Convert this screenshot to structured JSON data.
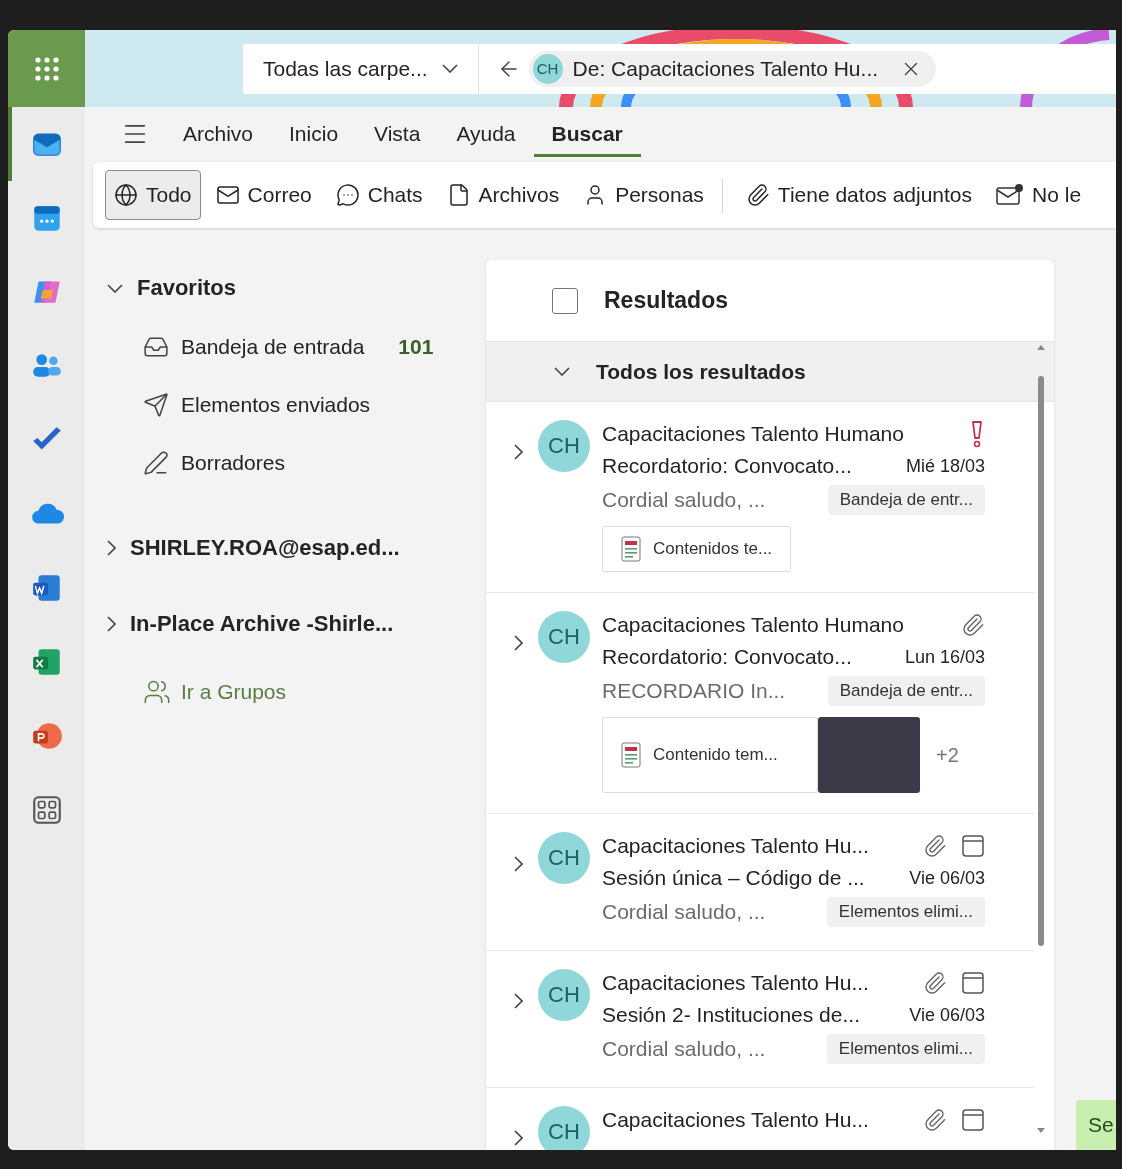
{
  "header": {
    "folder_scope": "Todas las carpe...",
    "search_chip": {
      "avatar": "CH",
      "text": "De: Capacitaciones Talento Hu..."
    }
  },
  "app_rail": [
    {
      "kind": "mail",
      "selected": true
    },
    {
      "kind": "calendar",
      "selected": false
    },
    {
      "kind": "copilot",
      "selected": false
    },
    {
      "kind": "people",
      "selected": false
    },
    {
      "kind": "todo",
      "selected": false
    },
    {
      "kind": "cloud",
      "selected": false
    },
    {
      "kind": "word",
      "selected": false
    },
    {
      "kind": "excel",
      "selected": false
    },
    {
      "kind": "powerpoint",
      "selected": false
    },
    {
      "kind": "apps",
      "selected": false
    }
  ],
  "ribbon_tabs": [
    {
      "label": "Archivo",
      "selected": false
    },
    {
      "label": "Inicio",
      "selected": false
    },
    {
      "label": "Vista",
      "selected": false
    },
    {
      "label": "Ayuda",
      "selected": false
    },
    {
      "label": "Buscar",
      "selected": true
    }
  ],
  "filters": [
    {
      "label": "Todo",
      "kind": "globe",
      "selected": true,
      "separator_before": false
    },
    {
      "label": "Correo",
      "kind": "mail",
      "selected": false,
      "separator_before": false
    },
    {
      "label": "Chats",
      "kind": "chat",
      "selected": false,
      "separator_before": false
    },
    {
      "label": "Archivos",
      "kind": "file",
      "selected": false,
      "separator_before": false
    },
    {
      "label": "Personas",
      "kind": "person",
      "selected": false,
      "separator_before": false
    },
    {
      "label": "Tiene datos adjuntos",
      "kind": "paperclip",
      "selected": false,
      "separator_before": true
    },
    {
      "label": "No le",
      "kind": "unread",
      "selected": false,
      "separator_before": false
    }
  ],
  "folders": {
    "favorites": {
      "label": "Favoritos",
      "expanded": true,
      "items": [
        {
          "label": "Bandeja de entrada",
          "kind": "inbox",
          "count": "101"
        },
        {
          "label": "Elementos enviados",
          "kind": "send"
        },
        {
          "label": "Borradores",
          "kind": "draft"
        }
      ]
    },
    "accounts": [
      {
        "label": "SHIRLEY.ROA@esap.ed...",
        "expanded": false
      },
      {
        "label": "In-Place Archive -Shirle...",
        "expanded": false
      }
    ],
    "groups_link": "Ir a Grupos"
  },
  "results": {
    "title": "Resultados",
    "select_all_checked": false,
    "group": {
      "label": "Todos los resultados",
      "expanded": true
    },
    "items": [
      {
        "avatar": "CH",
        "sender": "Capacitaciones Talento Humano",
        "important": true,
        "attachment": false,
        "calendar": false,
        "subject": "Recordatorio: Convocato...",
        "date": "Mié 18/03",
        "preview": "Cordial saludo, ...",
        "folder": "Bandeja de entr...",
        "attachments": [
          {
            "name": "Contenidos te..."
          }
        ],
        "thumbnail": false
      },
      {
        "avatar": "CH",
        "sender": "Capacitaciones Talento Humano",
        "important": false,
        "attachment": true,
        "calendar": false,
        "subject": "Recordatorio: Convocato...",
        "date": "Lun 16/03",
        "preview": "RECORDARIO In...",
        "folder": "Bandeja de entr...",
        "attachments": [
          {
            "name": "Contenido tem..."
          }
        ],
        "thumbnail": true,
        "more": "+2"
      },
      {
        "avatar": "CH",
        "sender": "Capacitaciones Talento Hu...",
        "important": false,
        "attachment": true,
        "calendar": true,
        "subject": "Sesión única – Código de ...",
        "date": "Vie 06/03",
        "preview": "Cordial saludo, ...",
        "folder": "Elementos elimi..."
      },
      {
        "avatar": "CH",
        "sender": "Capacitaciones Talento Hu...",
        "important": false,
        "attachment": true,
        "calendar": true,
        "subject": "Sesión 2- Instituciones de...",
        "date": "Vie 06/03",
        "preview": "Cordial saludo, ...",
        "folder": "Elementos elimi..."
      },
      {
        "avatar": "CH",
        "sender": "Capacitaciones Talento Hu...",
        "important": false,
        "attachment": true,
        "calendar": true
      }
    ]
  },
  "side_button": "Se"
}
